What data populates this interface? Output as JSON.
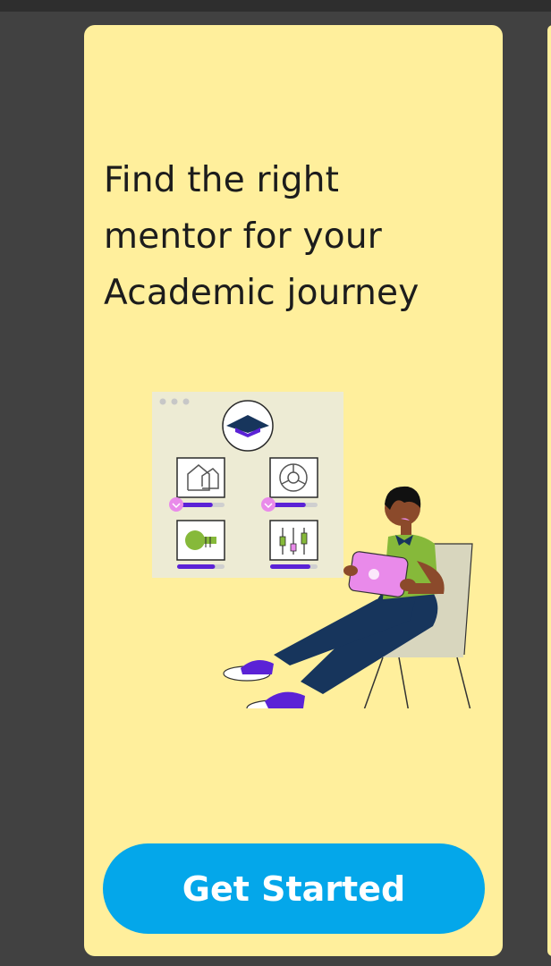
{
  "onboarding": {
    "headline_lines": [
      "Find the right",
      "mentor for your",
      "Academic journey"
    ],
    "cta_label": "Get Started"
  },
  "colors": {
    "background": "#414141",
    "card": "#FFEF9C",
    "cta": "#04A7EA",
    "cta_text": "#FFFFFF",
    "accent_purple": "#5B22D6",
    "accent_pink": "#E98AEA",
    "accent_green": "#86B93A",
    "navy": "#17355C"
  },
  "illustration": {
    "icons": [
      "graduation-cap-icon",
      "house-icon",
      "pie-chart-icon",
      "toggle-icon",
      "equalizer-icon"
    ],
    "progress_levels": [
      0.75,
      0.75,
      0.8,
      0.85
    ]
  }
}
